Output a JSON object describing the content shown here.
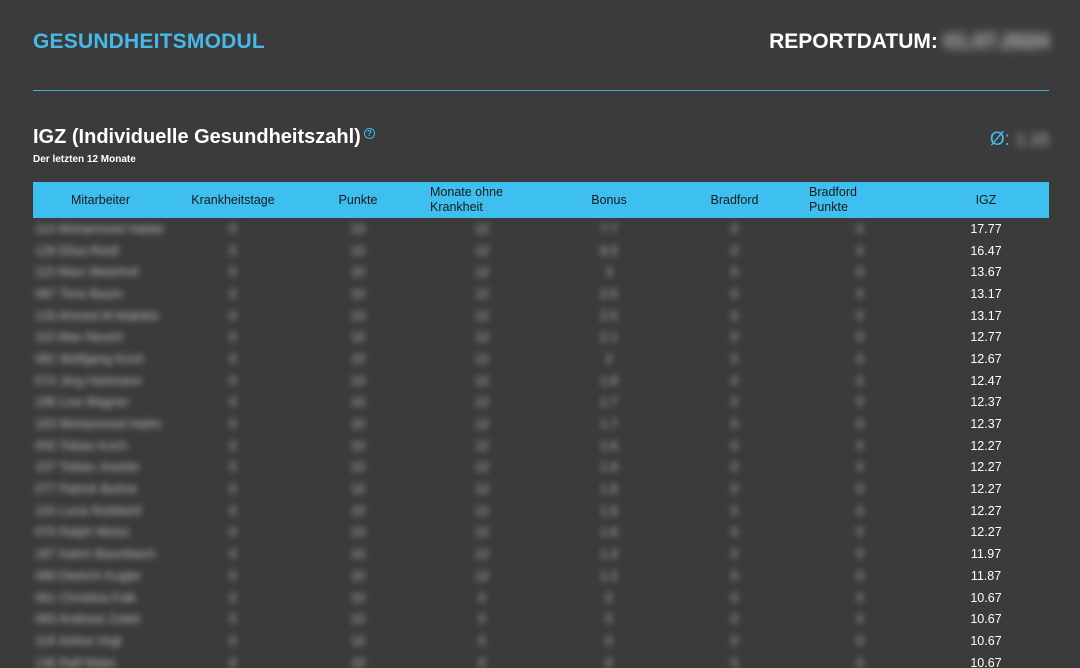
{
  "header": {
    "module_title": "GESUNDHEITSMODUL",
    "report_date_label": "REPORTDATUM:",
    "report_date_value": "01.07.2024"
  },
  "section": {
    "title": "IGZ (Individuelle Gesundheitszahl)",
    "help_icon": "?",
    "subtitle": "Der letzten 12 Monate",
    "avg_symbol": "Ø:",
    "avg_value": "1.15"
  },
  "colors": {
    "accent": "#45b9ea",
    "header_bg": "#3dbfef",
    "page_bg": "#3b3b3b"
  },
  "table": {
    "columns": [
      "Mitarbeiter",
      "Krankheitstage",
      "Punkte",
      "Monate ohne Krankheit",
      "Bonus",
      "Bradford",
      "Bradford Punkte",
      "IGZ"
    ],
    "column_lines": [
      [
        "Mitarbeiter"
      ],
      [
        "Krankheitstage"
      ],
      [
        "Punkte"
      ],
      [
        "Monate ohne",
        "Krankheit"
      ],
      [
        "Bonus"
      ],
      [
        "Bradford"
      ],
      [
        "Bradford",
        "Punkte"
      ],
      [
        "IGZ"
      ]
    ],
    "rows": [
      {
        "name": "114 Mohammed Haider",
        "krank": "0",
        "punkte": "10",
        "monate": "12",
        "bonus": "7.7",
        "bradford": "0",
        "bpunkte": "0",
        "igz": "17.77"
      },
      {
        "name": "128 Elisa Riedl",
        "krank": "0",
        "punkte": "10",
        "monate": "12",
        "bonus": "6.5",
        "bradford": "0",
        "bpunkte": "0",
        "igz": "16.47"
      },
      {
        "name": "115 Marc Meierhof",
        "krank": "0",
        "punkte": "10",
        "monate": "12",
        "bonus": "3",
        "bradford": "0",
        "bpunkte": "0",
        "igz": "13.67"
      },
      {
        "name": "087 Timo Baum",
        "krank": "0",
        "punkte": "10",
        "monate": "12",
        "bonus": "2.5",
        "bradford": "0",
        "bpunkte": "0",
        "igz": "13.17"
      },
      {
        "name": "133 Ahmed Al-Makdisi",
        "krank": "0",
        "punkte": "10",
        "monate": "12",
        "bonus": "2.5",
        "bradford": "0",
        "bpunkte": "0",
        "igz": "13.17"
      },
      {
        "name": "110 Max Neuert",
        "krank": "0",
        "punkte": "10",
        "monate": "12",
        "bonus": "2.1",
        "bradford": "0",
        "bpunkte": "0",
        "igz": "12.77"
      },
      {
        "name": "081 Wolfgang Koch",
        "krank": "0",
        "punkte": "10",
        "monate": "12",
        "bonus": "2",
        "bradford": "0",
        "bpunkte": "0",
        "igz": "12.67"
      },
      {
        "name": "074 Jörg Hartmann",
        "krank": "0",
        "punkte": "10",
        "monate": "12",
        "bonus": "1.8",
        "bradford": "0",
        "bpunkte": "0",
        "igz": "12.47"
      },
      {
        "name": "196 Lisa Wagner",
        "krank": "0",
        "punkte": "10",
        "monate": "12",
        "bonus": "1.7",
        "bradford": "0",
        "bpunkte": "0",
        "igz": "12.37"
      },
      {
        "name": "163 Mohammed Hatim",
        "krank": "0",
        "punkte": "10",
        "monate": "12",
        "bonus": "1.7",
        "bradford": "0",
        "bpunkte": "0",
        "igz": "12.37"
      },
      {
        "name": "050 Tobias Koch",
        "krank": "0",
        "punkte": "10",
        "monate": "12",
        "bonus": "1.6",
        "bradford": "0",
        "bpunkte": "0",
        "igz": "12.27"
      },
      {
        "name": "107 Tobias Joseter",
        "krank": "0",
        "punkte": "10",
        "monate": "12",
        "bonus": "1.6",
        "bradford": "0",
        "bpunkte": "0",
        "igz": "12.27"
      },
      {
        "name": "077 Patrick Buhne",
        "krank": "0",
        "punkte": "10",
        "monate": "12",
        "bonus": "1.6",
        "bradford": "0",
        "bpunkte": "0",
        "igz": "12.27"
      },
      {
        "name": "116 Lucia Rothkehl",
        "krank": "0",
        "punkte": "10",
        "monate": "12",
        "bonus": "1.6",
        "bradford": "0",
        "bpunkte": "0",
        "igz": "12.27"
      },
      {
        "name": "070 Ralph Weiss",
        "krank": "0",
        "punkte": "10",
        "monate": "12",
        "bonus": "1.6",
        "bradford": "0",
        "bpunkte": "0",
        "igz": "12.27"
      },
      {
        "name": "187 Katrin Baumbach",
        "krank": "0",
        "punkte": "10",
        "monate": "12",
        "bonus": "1.3",
        "bradford": "0",
        "bpunkte": "0",
        "igz": "11.97"
      },
      {
        "name": "089 Dietrich Kugler",
        "krank": "0",
        "punkte": "10",
        "monate": "12",
        "bonus": "1.2",
        "bradford": "0",
        "bpunkte": "0",
        "igz": "11.87"
      },
      {
        "name": "061 Christina Falk",
        "krank": "0",
        "punkte": "10",
        "monate": "0",
        "bonus": "0",
        "bradford": "0",
        "bpunkte": "0",
        "igz": "10.67"
      },
      {
        "name": "083 Andreas Zobel",
        "krank": "0",
        "punkte": "10",
        "monate": "0",
        "bonus": "0",
        "bradford": "0",
        "bpunkte": "0",
        "igz": "10.67"
      },
      {
        "name": "118 Selina Vogt",
        "krank": "0",
        "punkte": "10",
        "monate": "0",
        "bonus": "0",
        "bradford": "0",
        "bpunkte": "0",
        "igz": "10.67"
      },
      {
        "name": "136 Ralf Maier",
        "krank": "0",
        "punkte": "10",
        "monate": "0",
        "bonus": "0",
        "bradford": "0",
        "bpunkte": "0",
        "igz": "10.67"
      }
    ]
  }
}
